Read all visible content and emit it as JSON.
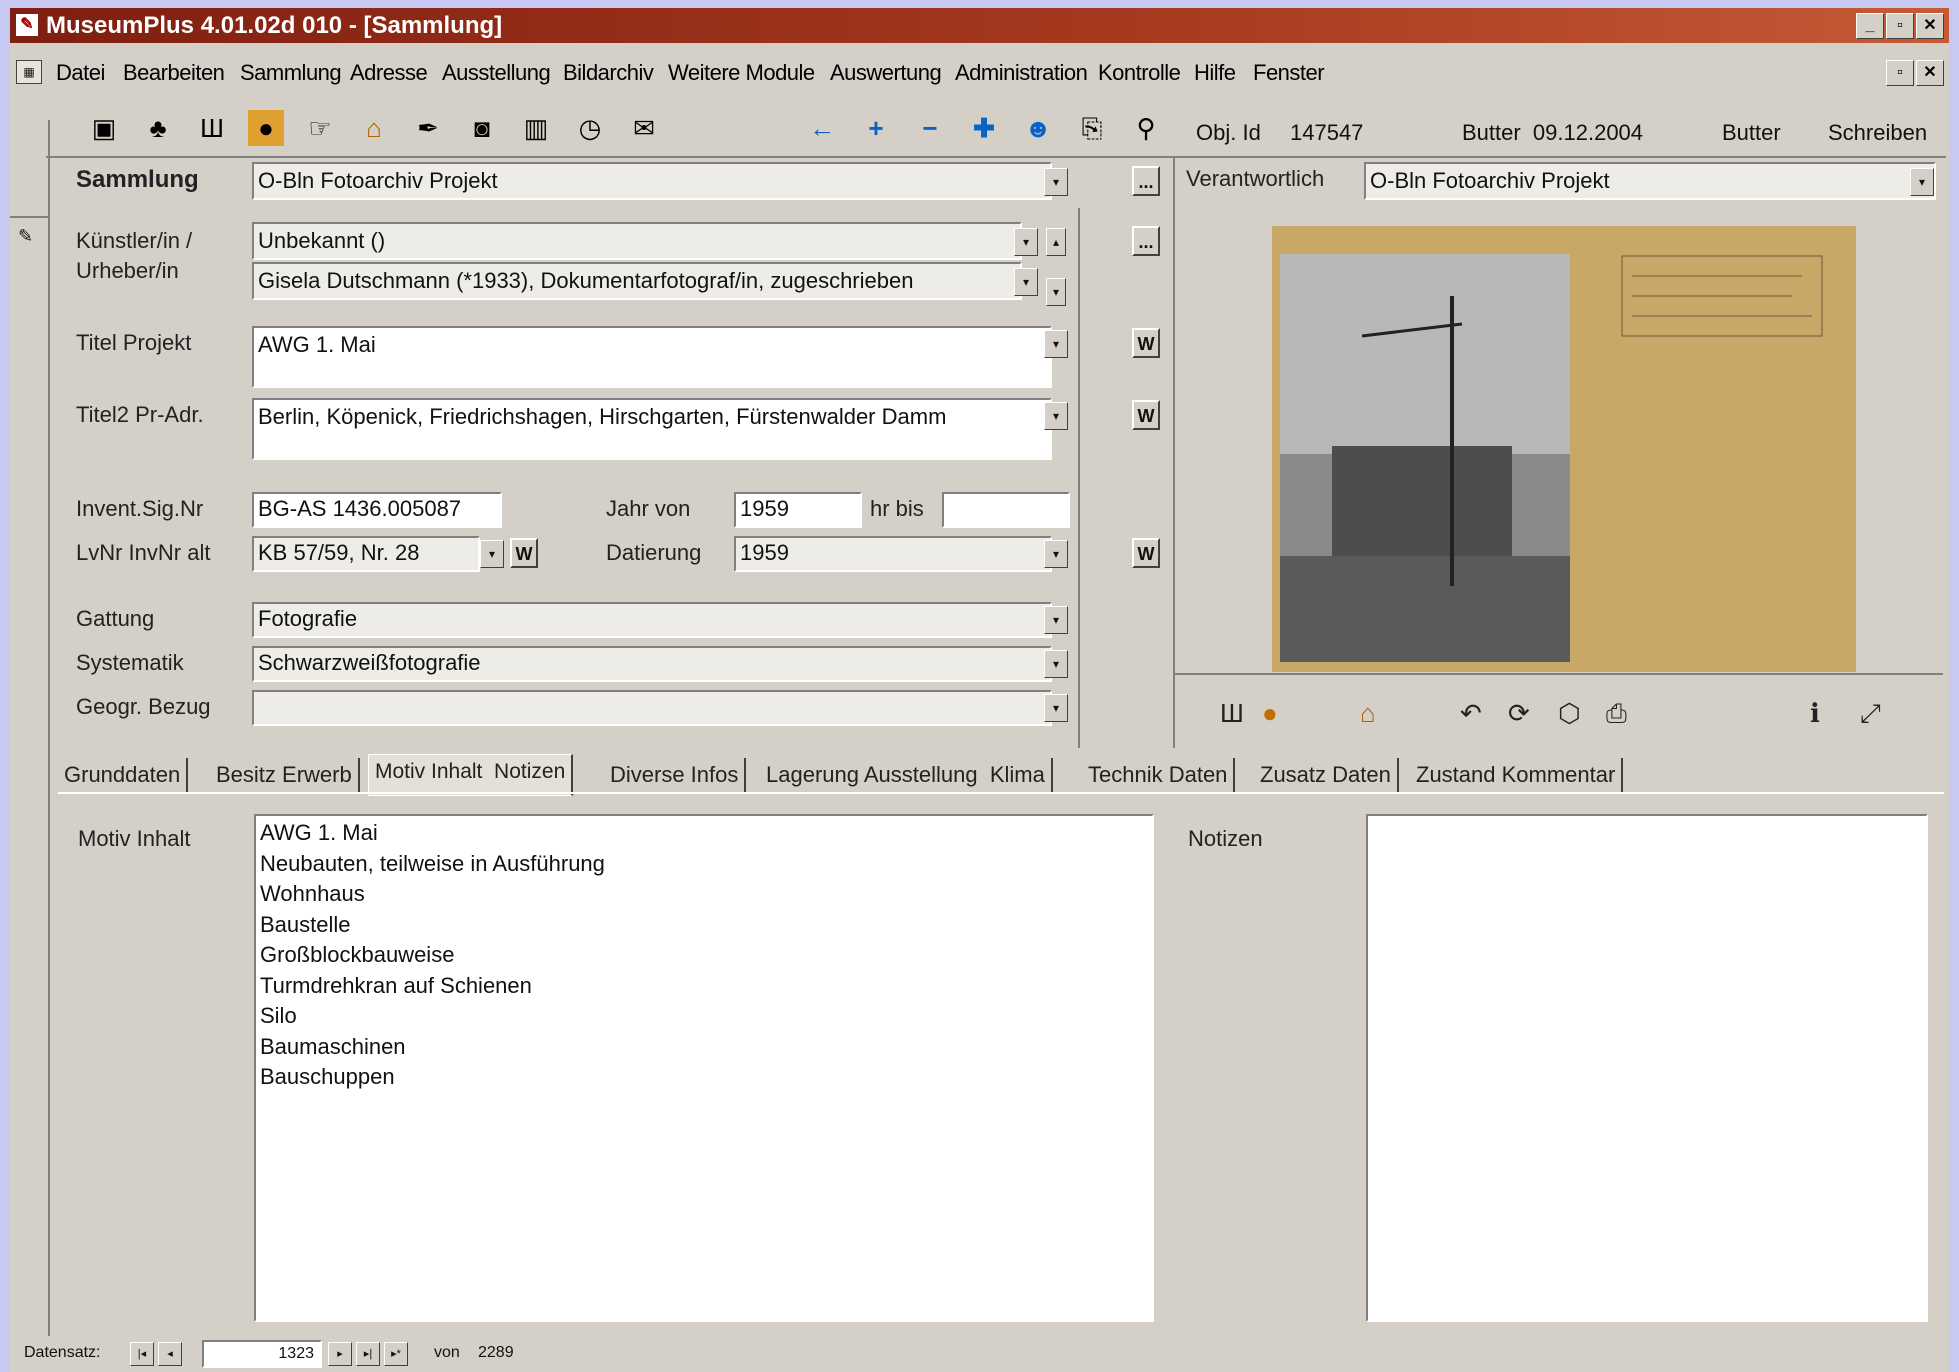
{
  "window": {
    "title": "MuseumPlus 4.01.02d 010 - [Sammlung]",
    "controls": {
      "minimize": "_",
      "restore": "▫",
      "close": "✕"
    }
  },
  "menu": [
    "Datei",
    "Bearbeiten",
    "Sammlung",
    "Adresse",
    "Ausstellung",
    "Bildarchiv",
    "Weitere Module",
    "Auswertung",
    "Administration",
    "Kontrolle",
    "Hilfe",
    "Fenster"
  ],
  "objinfo": {
    "id_label": "Obj. Id",
    "id_value": "147547",
    "user_date": "Butter  09.12.2004",
    "user": "Butter",
    "mode": "Schreiben"
  },
  "form": {
    "sammlung_label": "Sammlung",
    "sammlung_value": "O-Bln Fotoarchiv Projekt",
    "verantwortlich_label": "Verantwortlich",
    "verantwortlich_value": "O-Bln Fotoarchiv Projekt",
    "kuenstler_label_1": "Künstler/in /",
    "kuenstler_label_2": "Urheber/in",
    "kuenstler_1": "Unbekannt ()",
    "kuenstler_2": "Gisela Dutschmann (*1933), Dokumentarfotograf/in, zugeschrieben",
    "titel_label": "Titel Projekt",
    "titel_value": "AWG 1. Mai",
    "titel2_label": "Titel2 Pr-Adr.",
    "titel2_value": "Berlin, Köpenick, Friedrichshagen, Hirschgarten, Fürstenwalder Damm",
    "invent_label": "Invent.Sig.Nr",
    "invent_value": "BG-AS 1436.005087",
    "jahr_von_label": "Jahr von",
    "jahr_von_value": "1959",
    "jahr_bis_label": "hr bis",
    "jahr_bis_value": "",
    "lvnr_label": "LvNr InvNr alt",
    "lvnr_value": "KB 57/59, Nr. 28",
    "datierung_label": "Datierung",
    "datierung_value": "1959",
    "gattung_label": "Gattung",
    "gattung_value": "Fotografie",
    "systematik_label": "Systematik",
    "systematik_value": "Schwarzweißfotografie",
    "geogr_label": "Geogr. Bezug",
    "geogr_value": "",
    "ellipsis": "...",
    "w": "W"
  },
  "tabs": [
    {
      "label": "Grunddaten",
      "active": false
    },
    {
      "label": "Besitz Erwerb",
      "active": false
    },
    {
      "label": "Motiv Inhalt  Notizen",
      "active": true
    },
    {
      "label": "Diverse Infos",
      "active": false
    },
    {
      "label": "Lagerung Ausstellung  Klima",
      "active": false
    },
    {
      "label": "Technik Daten",
      "active": false
    },
    {
      "label": "Zusatz Daten",
      "active": false
    },
    {
      "label": "Zustand Kommentar",
      "active": false
    }
  ],
  "motiv": {
    "label": "Motiv Inhalt",
    "lines": [
      "AWG 1. Mai",
      "Neubauten, teilweise in Ausführung",
      "Wohnhaus",
      "Baustelle",
      "Großblockbauweise",
      "Turmdrehkran auf Schienen",
      "Silo",
      "Baumaschinen",
      "Bauschuppen"
    ]
  },
  "notizen": {
    "label": "Notizen",
    "value": ""
  },
  "status": {
    "label": "Datensatz:",
    "current": "1323",
    "of_label": "von",
    "total": "2289"
  },
  "icons": {
    "toolbar": [
      "window-icon",
      "binoculars-icon",
      "book-icon",
      "eye-icon",
      "hand-icon",
      "house-icon",
      "pen-icon",
      "camera-icon",
      "film-icon",
      "clock-icon",
      "mail-icon"
    ],
    "nav": [
      "arrow-left-icon",
      "plus-icon",
      "minus-icon",
      "cross-icon",
      "person-icon",
      "preview-icon",
      "search-icon"
    ]
  }
}
